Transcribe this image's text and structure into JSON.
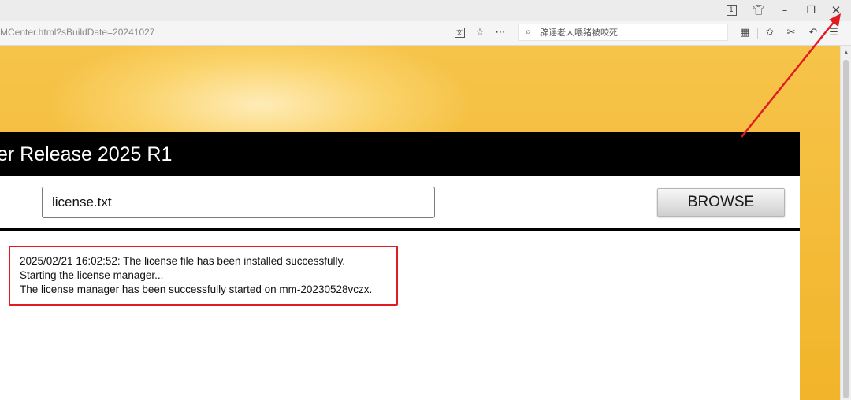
{
  "window_controls": {
    "tab_count": "1",
    "skin_icon": "shirt-icon",
    "minimize_icon": "minimize-icon",
    "restore_icon": "restore-icon",
    "close_icon": "close-icon"
  },
  "toolbar": {
    "url": "MCenter.html?sBuildDate=20241027",
    "icons": [
      "translate-icon",
      "star-icon",
      "more-icon"
    ],
    "search_placeholder": "辟谣老人喂猪被咬死",
    "right_icons": [
      "apps-grid-icon",
      "favorites-icon",
      "scissors-icon",
      "undo-icon",
      "menu-icon"
    ]
  },
  "panel": {
    "title": "er Release 2025 R1",
    "file_value": "license.txt",
    "browse_label": "BROWSE"
  },
  "log": {
    "lines": [
      "2025/02/21 16:02:52: The license file has been installed successfully.",
      "Starting the license manager...",
      "The license manager has been successfully started on mm-20230528vczx."
    ]
  },
  "colors": {
    "banner": "#f3b62c",
    "header": "#000000",
    "highlight": "#e21b23"
  }
}
